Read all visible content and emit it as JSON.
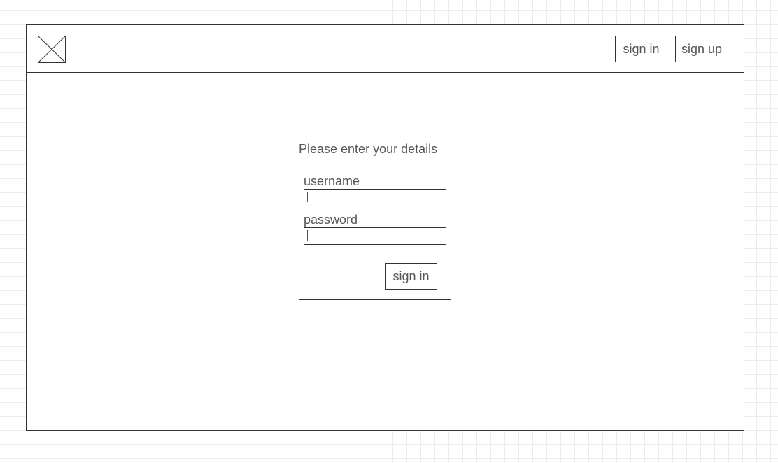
{
  "header": {
    "logo_icon": "image-placeholder-icon",
    "sign_in_label": "sign in",
    "sign_up_label": "sign up"
  },
  "login": {
    "prompt": "Please enter your details",
    "username_label": "username",
    "username_value": "",
    "password_label": "password",
    "password_value": "",
    "submit_label": "sign in"
  },
  "colors": {
    "border": "#333333",
    "text": "#555555",
    "grid": "#ececec",
    "background": "#ffffff"
  }
}
